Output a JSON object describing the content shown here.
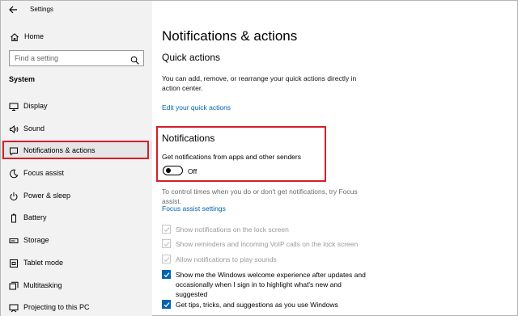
{
  "window": {
    "title": "Settings"
  },
  "sidebar": {
    "home_label": "Home",
    "search_placeholder": "Find a setting",
    "section_heading": "System",
    "items": [
      {
        "label": "Display",
        "icon": "display-icon"
      },
      {
        "label": "Sound",
        "icon": "sound-icon"
      },
      {
        "label": "Notifications & actions",
        "icon": "notifications-icon",
        "selected": true
      },
      {
        "label": "Focus assist",
        "icon": "focus-assist-icon"
      },
      {
        "label": "Power & sleep",
        "icon": "power-icon"
      },
      {
        "label": "Battery",
        "icon": "battery-icon"
      },
      {
        "label": "Storage",
        "icon": "storage-icon"
      },
      {
        "label": "Tablet mode",
        "icon": "tablet-icon"
      },
      {
        "label": "Multitasking",
        "icon": "multitasking-icon"
      },
      {
        "label": "Projecting to this PC",
        "icon": "projecting-icon"
      }
    ]
  },
  "main": {
    "page_title": "Notifications & actions",
    "quick_actions": {
      "heading": "Quick actions",
      "description": "You can add, remove, or rearrange your quick actions directly in action center.",
      "link": "Edit your quick actions"
    },
    "notifications": {
      "heading": "Notifications",
      "setting_label": "Get notifications from apps and other senders",
      "toggle_state": "Off",
      "focus_note": "To control times when you do or don't get notifications, try Focus assist.",
      "focus_link": "Focus assist settings"
    },
    "checkboxes": [
      {
        "label": "Show notifications on the lock screen",
        "checked": true,
        "disabled": true
      },
      {
        "label": "Show reminders and incoming VoIP calls on the lock screen",
        "checked": true,
        "disabled": true
      },
      {
        "label": "Allow notifications to play sounds",
        "checked": true,
        "disabled": true
      },
      {
        "label": "Show me the Windows welcome experience after updates and occasionally when I sign in to highlight what's new and suggested",
        "checked": true,
        "disabled": false
      },
      {
        "label": "Get tips, tricks, and suggestions as you use Windows",
        "checked": true,
        "disabled": false
      }
    ]
  },
  "colors": {
    "accent": "#0063b1",
    "highlight": "#d4202a",
    "sidebar_bg": "#f2f2f2"
  }
}
